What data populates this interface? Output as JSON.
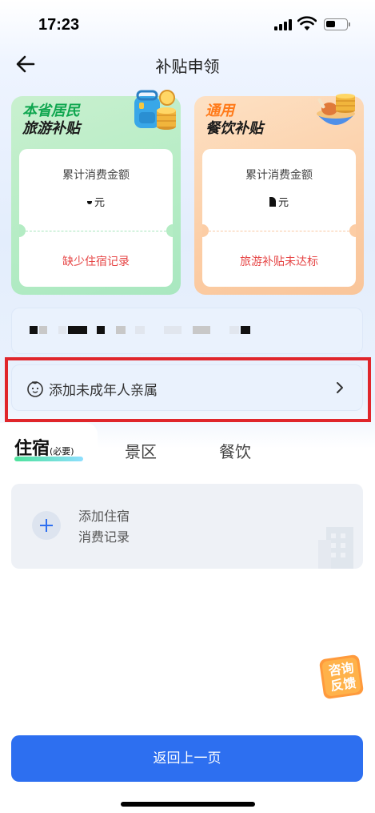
{
  "status_bar": {
    "time": "17:23"
  },
  "nav": {
    "title": "补贴申领"
  },
  "cards": [
    {
      "tag_line1": "本省居民",
      "tag_line2": "旅游补贴",
      "label": "累计消费金额",
      "unit": "元",
      "status": "缺少住宿记录",
      "accent": "#0fa64f"
    },
    {
      "tag_line1": "通用",
      "tag_line2": "餐饮补贴",
      "label": "累计消费金额",
      "unit": "元",
      "status": "旅游补贴未达标",
      "accent": "#ff7a1a"
    }
  ],
  "minor_row": {
    "label": "添加未成年人亲属",
    "icon": "baby-face-icon"
  },
  "tabs": {
    "active": {
      "label": "住宿",
      "sub": "(必要)"
    },
    "others": [
      "景区",
      "餐饮"
    ]
  },
  "add_record": {
    "line1": "添加住宿",
    "line2": "消费记录"
  },
  "consult": {
    "line1": "咨询",
    "line2": "反馈"
  },
  "footer": {
    "button_label": "返回上一页"
  },
  "colors": {
    "primary": "#2d6ff0",
    "warning": "#e64545",
    "highlight_border": "#e0262b"
  }
}
